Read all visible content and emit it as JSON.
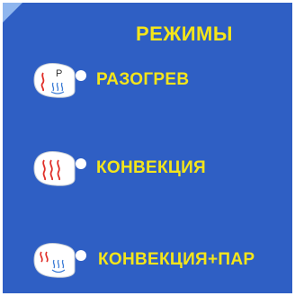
{
  "panel": {
    "title": "РЕЖИМЫ"
  },
  "modes": [
    {
      "label": "РАЗОГРЕВ",
      "icon": "preheat-icon"
    },
    {
      "label": "КОНВЕКЦИЯ",
      "icon": "convection-icon"
    },
    {
      "label": "КОНВЕКЦИЯ+ПАР",
      "icon": "convection-steam-icon"
    }
  ],
  "icons": {
    "preheat_letter": "P"
  },
  "colors": {
    "background": "#2f5fc4",
    "text": "#f4e51a",
    "heat": "#e0302a",
    "steam": "#3a7bd5",
    "corner": "#8fb6ee"
  }
}
